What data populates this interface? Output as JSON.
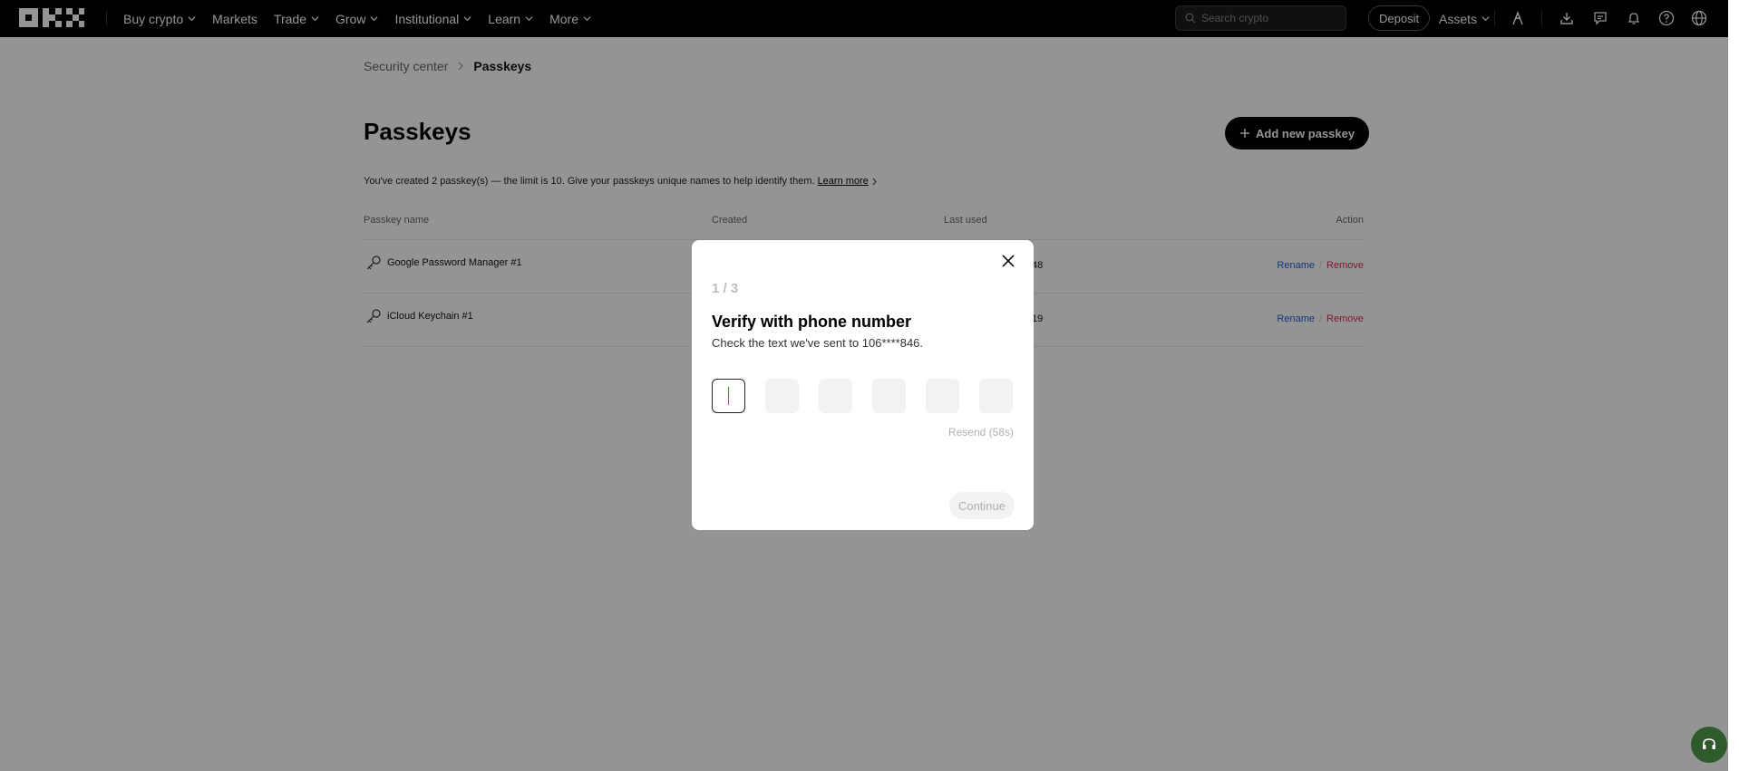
{
  "nav": {
    "items": [
      {
        "label": "Buy crypto",
        "has_dropdown": true
      },
      {
        "label": "Markets",
        "has_dropdown": false
      },
      {
        "label": "Trade",
        "has_dropdown": true
      },
      {
        "label": "Grow",
        "has_dropdown": true
      },
      {
        "label": "Institutional",
        "has_dropdown": true
      },
      {
        "label": "Learn",
        "has_dropdown": true
      },
      {
        "label": "More",
        "has_dropdown": true
      }
    ],
    "search_placeholder": "Search crypto",
    "deposit_label": "Deposit",
    "assets_label": "Assets",
    "icons": [
      "user-icon",
      "download-icon",
      "chat-icon",
      "bell-icon",
      "help-icon",
      "globe-icon"
    ]
  },
  "breadcrumb": {
    "parent": "Security center",
    "current": "Passkeys"
  },
  "page": {
    "title": "Passkeys",
    "add_button": "Add new passkey",
    "info_text": "You've created 2 passkey(s) — the limit is 10. Give your passkeys unique names to help identify them.",
    "learn_more": "Learn more"
  },
  "table": {
    "headers": {
      "name": "Passkey name",
      "created": "Created",
      "last_used": "Last used",
      "action": "Action"
    },
    "rows": [
      {
        "name": "Google Password Manager #1",
        "last_used_visible": "48",
        "rename": "Rename",
        "remove": "Remove"
      },
      {
        "name": "iCloud Keychain #1",
        "last_used_visible": "19",
        "rename": "Rename",
        "remove": "Remove"
      }
    ]
  },
  "modal": {
    "step": "1 / 3",
    "title": "Verify with phone number",
    "subtitle": "Check the text we've sent to 106****846.",
    "otp_count": 6,
    "resend": "Resend (58s)",
    "continue": "Continue"
  },
  "colors": {
    "nav_bg": "#000000",
    "link_blue": "#1e5cd6",
    "remove_red": "#d8304d",
    "support_green": "#2f5a2c"
  }
}
